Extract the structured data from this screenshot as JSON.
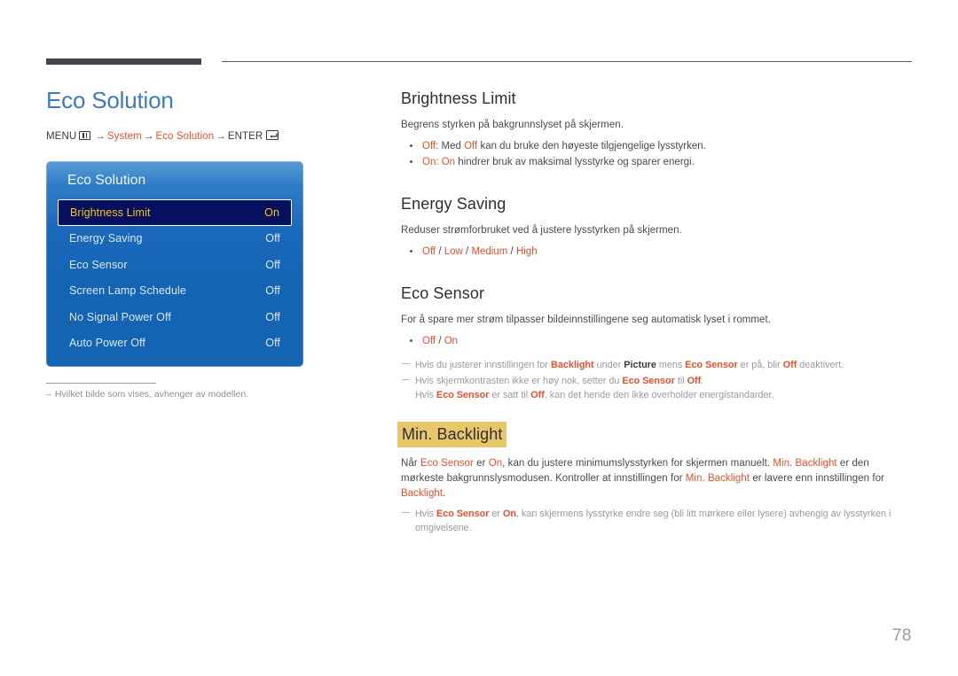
{
  "page": {
    "number": "78",
    "title": "Eco Solution"
  },
  "menu_path": {
    "prefix": "MENU",
    "menu_icon": "menu-grid-icon",
    "arrow": "→",
    "step1": "System",
    "step2": "Eco Solution",
    "enter": "ENTER",
    "enter_icon": "enter-return-icon"
  },
  "osd": {
    "title": "Eco Solution",
    "rows": [
      {
        "label": "Brightness Limit",
        "value": "On",
        "selected": true
      },
      {
        "label": "Energy Saving",
        "value": "Off",
        "selected": false
      },
      {
        "label": "Eco Sensor",
        "value": "Off",
        "selected": false
      },
      {
        "label": "Screen Lamp Schedule",
        "value": "Off",
        "selected": false
      },
      {
        "label": "No Signal Power Off",
        "value": "Off",
        "selected": false
      },
      {
        "label": "Auto Power Off",
        "value": "Off",
        "selected": false
      }
    ]
  },
  "left_note": {
    "dash": "–",
    "text": "Hvilket bilde som vises, avhenger av modellen."
  },
  "sections": {
    "brightness_limit": {
      "heading": "Brightness Limit",
      "intro": "Begrens styrken på bakgrunnslyset på skjermen.",
      "bullet1": {
        "term": "Off",
        "sep": ": Med ",
        "term2": "Off",
        "rest": " kan du bruke den høyeste tilgjengelige lysstyrken."
      },
      "bullet2": {
        "term": "On",
        "sep": ": ",
        "term2": "On",
        "rest": " hindrer bruk av maksimal lysstyrke og sparer energi."
      }
    },
    "energy_saving": {
      "heading": "Energy Saving",
      "intro": "Reduser strømforbruket ved å justere lysstyrken på skjermen.",
      "options": [
        "Off",
        "Low",
        "Medium",
        "High"
      ],
      "separator": " / "
    },
    "eco_sensor": {
      "heading": "Eco Sensor",
      "intro": "For å spare mer strøm tilpasser bildeinnstillingene seg automatisk lyset i rommet.",
      "options": [
        "Off",
        "On"
      ],
      "separator": " / ",
      "note1": {
        "p1": "Hvis du justerer innstillingen for ",
        "t1": "Backlight",
        "p2": " under ",
        "t2": "Picture",
        "p3": " mens ",
        "t3": "Eco Sensor",
        "p4": " er på, blir ",
        "t4": "Off",
        "p5": " deaktivert."
      },
      "note2": {
        "p1": "Hvis skjermkontrasten ikke er høy nok, setter du ",
        "t1": "Eco Sensor",
        "p2": " til ",
        "t2": "Off",
        "p3": ".",
        "c1": "Hvis ",
        "ct1": "Eco Sensor",
        "c2": " er satt til ",
        "ct2": "Off",
        "c3": ", kan det hende den ikke overholder energistandarder."
      }
    },
    "min_backlight": {
      "heading": "Min. Backlight",
      "body": {
        "p1": "Når ",
        "t1": "Eco Sensor",
        "p2": " er ",
        "t2": "On",
        "p3": ", kan du justere minimumslysstyrken for skjermen manuelt. ",
        "t3": "Min. Backlight",
        "p4": " er den mørkeste bakgrunnslysmodusen. Kontroller at innstillingen for ",
        "t4": "Min. Backlight",
        "p5": " er lavere enn innstillingen for ",
        "t5": "Backlight",
        "p6": "."
      },
      "note": {
        "p1": "Hvis ",
        "t1": "Eco Sensor",
        "p2": " er ",
        "t2": "On",
        "p3": ", kan skjermens lysstyrke endre seg (bli litt mørkere eller lysere) avhengig av lysstyrken i omgivelsene."
      }
    }
  },
  "colors": {
    "accent": "#e8512a",
    "title_blue": "#3d79c4",
    "osd_blue": "#1464b4",
    "osd_selected_bg": "#06105c",
    "osd_selected_text": "#f5c518",
    "highlight": "#e8c66a"
  }
}
